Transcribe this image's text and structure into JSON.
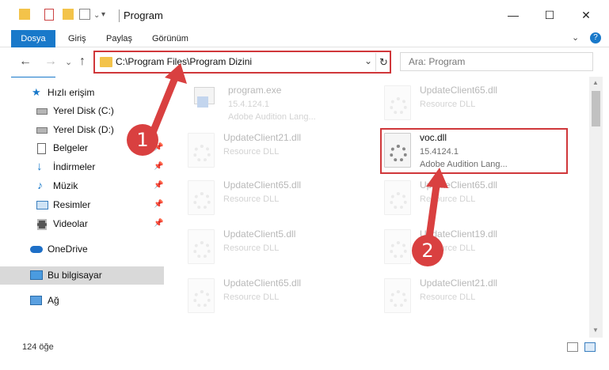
{
  "window": {
    "title": "Program",
    "minimize": "—",
    "maximize": "☐",
    "close": "✕"
  },
  "ribbon": {
    "tabs": [
      "Dosya",
      "Giriş",
      "Paylaş",
      "Görünüm"
    ],
    "expand": "⌄",
    "help": "?"
  },
  "nav": {
    "back": "←",
    "forward": "→",
    "recent": "⌄",
    "up": "↑"
  },
  "address": {
    "path": "C:\\Program Files\\Program Dizini",
    "dropdown": "⌄",
    "refresh": "↻"
  },
  "search": {
    "placeholder": "Ara: Program",
    "icon": "search-icon"
  },
  "sidebar": {
    "items": [
      {
        "label": "Hızlı erişim",
        "icon": "star-icon"
      },
      {
        "label": "Yerel Disk (C:)",
        "icon": "drive-icon"
      },
      {
        "label": "Yerel Disk (D:)",
        "icon": "drive-icon"
      },
      {
        "label": "Belgeler",
        "icon": "documents-icon"
      },
      {
        "label": "İndirmeler",
        "icon": "download-icon"
      },
      {
        "label": "Müzik",
        "icon": "music-icon"
      },
      {
        "label": "Resimler",
        "icon": "pictures-icon"
      },
      {
        "label": "Videolar",
        "icon": "video-icon"
      },
      {
        "label": "OneDrive",
        "icon": "cloud-icon"
      },
      {
        "label": "Bu bilgisayar",
        "icon": "computer-icon"
      },
      {
        "label": "Ağ",
        "icon": "network-icon"
      }
    ]
  },
  "files": [
    {
      "name": "program.exe",
      "line1": "15.4.124.1",
      "line2": "Adobe Audition Lang..."
    },
    {
      "name": "UpdateClient65.dll",
      "line1": "Resource DLL",
      "line2": ""
    },
    {
      "name": "UpdateClient21.dll",
      "line1": "Resource DLL",
      "line2": ""
    },
    {
      "name": "voc.dll",
      "line1": "15.4124.1",
      "line2": "Adobe Audition Lang..."
    },
    {
      "name": "UpdateClient65.dll",
      "line1": "Resource DLL",
      "line2": ""
    },
    {
      "name": "UpdateClient65.dll",
      "line1": "Resource DLL",
      "line2": ""
    },
    {
      "name": "UpdateClient5.dll",
      "line1": "Resource DLL",
      "line2": ""
    },
    {
      "name": "UpdateClient19.dll",
      "line1": "Resource DLL",
      "line2": ""
    },
    {
      "name": "UpdateClient65.dll",
      "line1": "Resource DLL",
      "line2": ""
    },
    {
      "name": "UpdateClient21.dll",
      "line1": "Resource DLL",
      "line2": ""
    }
  ],
  "status": {
    "count": "124 öğe"
  },
  "annotations": {
    "badge1": "1",
    "badge2": "2",
    "color": "#d94040"
  }
}
